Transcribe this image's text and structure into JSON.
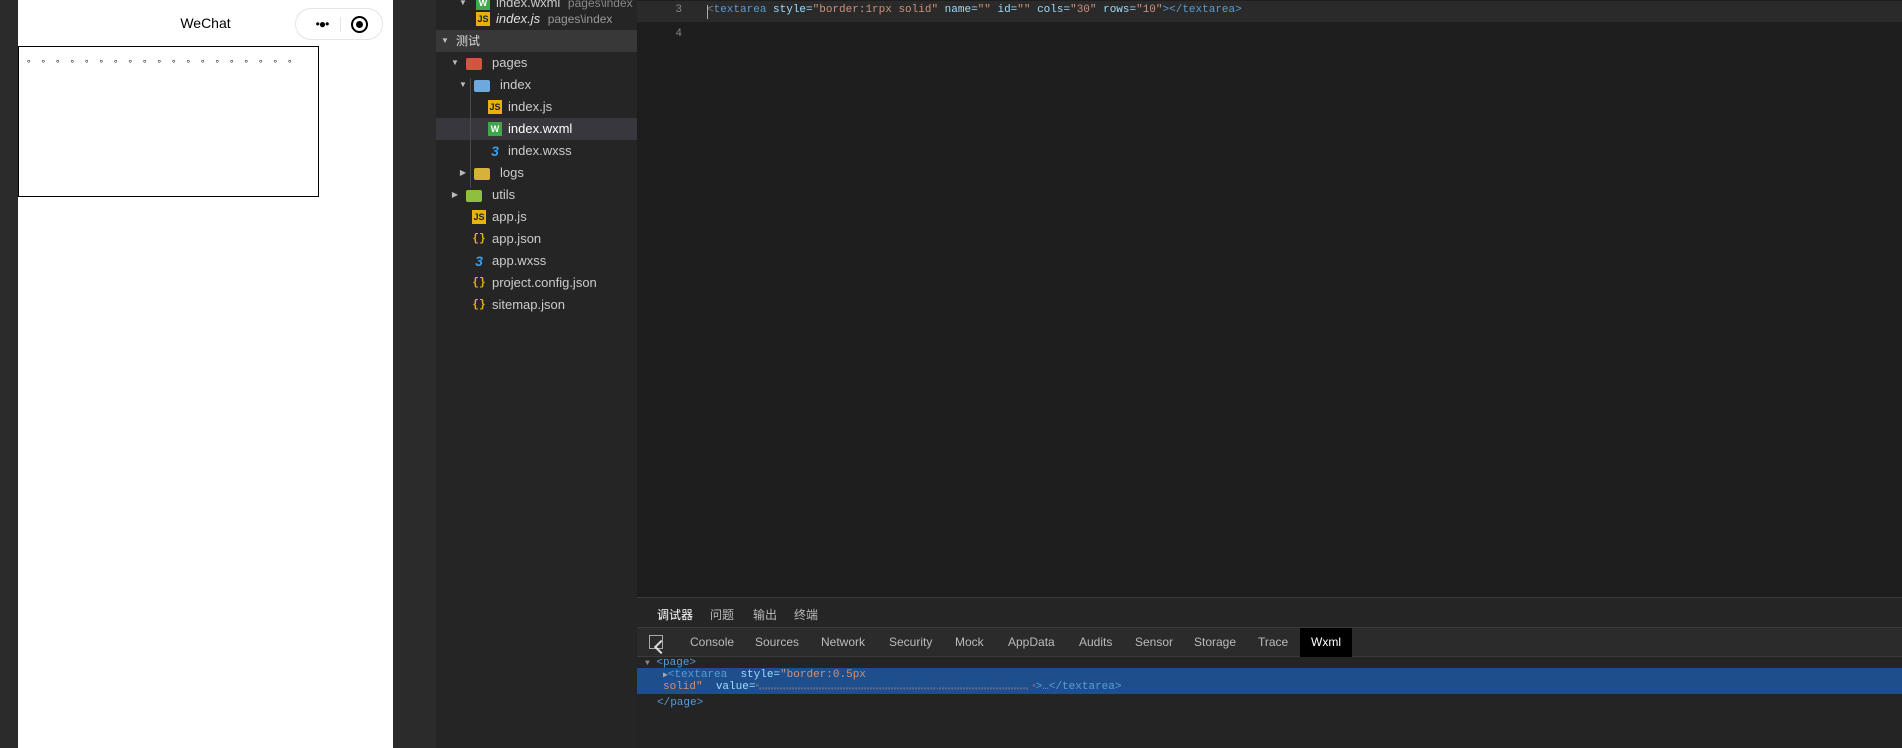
{
  "simulator": {
    "nav_title": "WeChat",
    "capsule_more": "•●•",
    "textarea_content": "。。。。。。。。。。。。。。。。。。。"
  },
  "explorer": {
    "open_editors": [
      {
        "label": "index.wxml",
        "path": "pages\\index",
        "icon": "wxml-file-icon"
      },
      {
        "label": "index.js",
        "path": "pages\\index",
        "icon": "js-file-icon"
      }
    ],
    "project_name": "测试",
    "tree": [
      {
        "label": "pages",
        "type": "folder",
        "icon": "folder-icon"
      },
      {
        "label": "index",
        "type": "folder",
        "icon": "folder-open-icon"
      },
      {
        "label": "index.js",
        "type": "file",
        "icon": "js-file-icon"
      },
      {
        "label": "index.wxml",
        "type": "file",
        "icon": "wxml-file-icon",
        "selected": true
      },
      {
        "label": "index.wxss",
        "type": "file",
        "icon": "wxss-file-icon"
      },
      {
        "label": "logs",
        "type": "folder",
        "icon": "folder-icon"
      },
      {
        "label": "utils",
        "type": "folder",
        "icon": "folder-icon"
      },
      {
        "label": "app.js",
        "type": "file",
        "icon": "js-file-icon"
      },
      {
        "label": "app.json",
        "type": "file",
        "icon": "json-file-icon"
      },
      {
        "label": "app.wxss",
        "type": "file",
        "icon": "wxss-file-icon"
      },
      {
        "label": "project.config.json",
        "type": "file",
        "icon": "json-file-icon"
      },
      {
        "label": "sitemap.json",
        "type": "file",
        "icon": "json-file-icon"
      }
    ]
  },
  "editor": {
    "lines": [
      {
        "number": "3",
        "code": "<textarea style=\"border:1rpx solid\" name=\"\" id=\"\" cols=\"30\" rows=\"10\"></textarea>"
      },
      {
        "number": "4",
        "code": ""
      }
    ],
    "code_tokens": {
      "open": "<",
      "tag": "textarea",
      "a1": " style=",
      "v1": "\"border:1rpx solid\"",
      "a2": " name=",
      "v2": "\"\"",
      "a3": " id=",
      "v3": "\"\"",
      "a4": " cols=",
      "v4": "\"30\"",
      "a5": " rows=",
      "v5": "\"10\"",
      "close": "></textarea>"
    }
  },
  "debugger": {
    "panel_tabs": [
      "调试器",
      "问题",
      "输出",
      "终端"
    ],
    "devtools_tabs": [
      "Console",
      "Sources",
      "Network",
      "Security",
      "Mock",
      "AppData",
      "Audits",
      "Sensor",
      "Storage",
      "Trace",
      "Wxml"
    ],
    "active_devtools_tab": "Wxml",
    "wxml": {
      "page_open": "<page>",
      "textarea_line1_tag": "<textarea",
      "textarea_line1_attr": " style=",
      "textarea_line1_val": "\"border:0.5px",
      "textarea_line2_val": "solid\"",
      "textarea_line2_attr": " value=",
      "textarea_line2_value": "\"。。。。。。。。。。。。。。。。。。。。。。。。。。。。。。。。。。。。。。。。。。。。。。。。。。。。。。。。。。。、。。。。。。。。。。。。。。。。。。。。。。。。。。。。。。\"",
      "textarea_line2_close": ">…</textarea>",
      "page_close": "</page>"
    }
  },
  "colors": {
    "selection": "#1e4f8c",
    "tag": "#569cd6",
    "string": "#ce9178"
  }
}
